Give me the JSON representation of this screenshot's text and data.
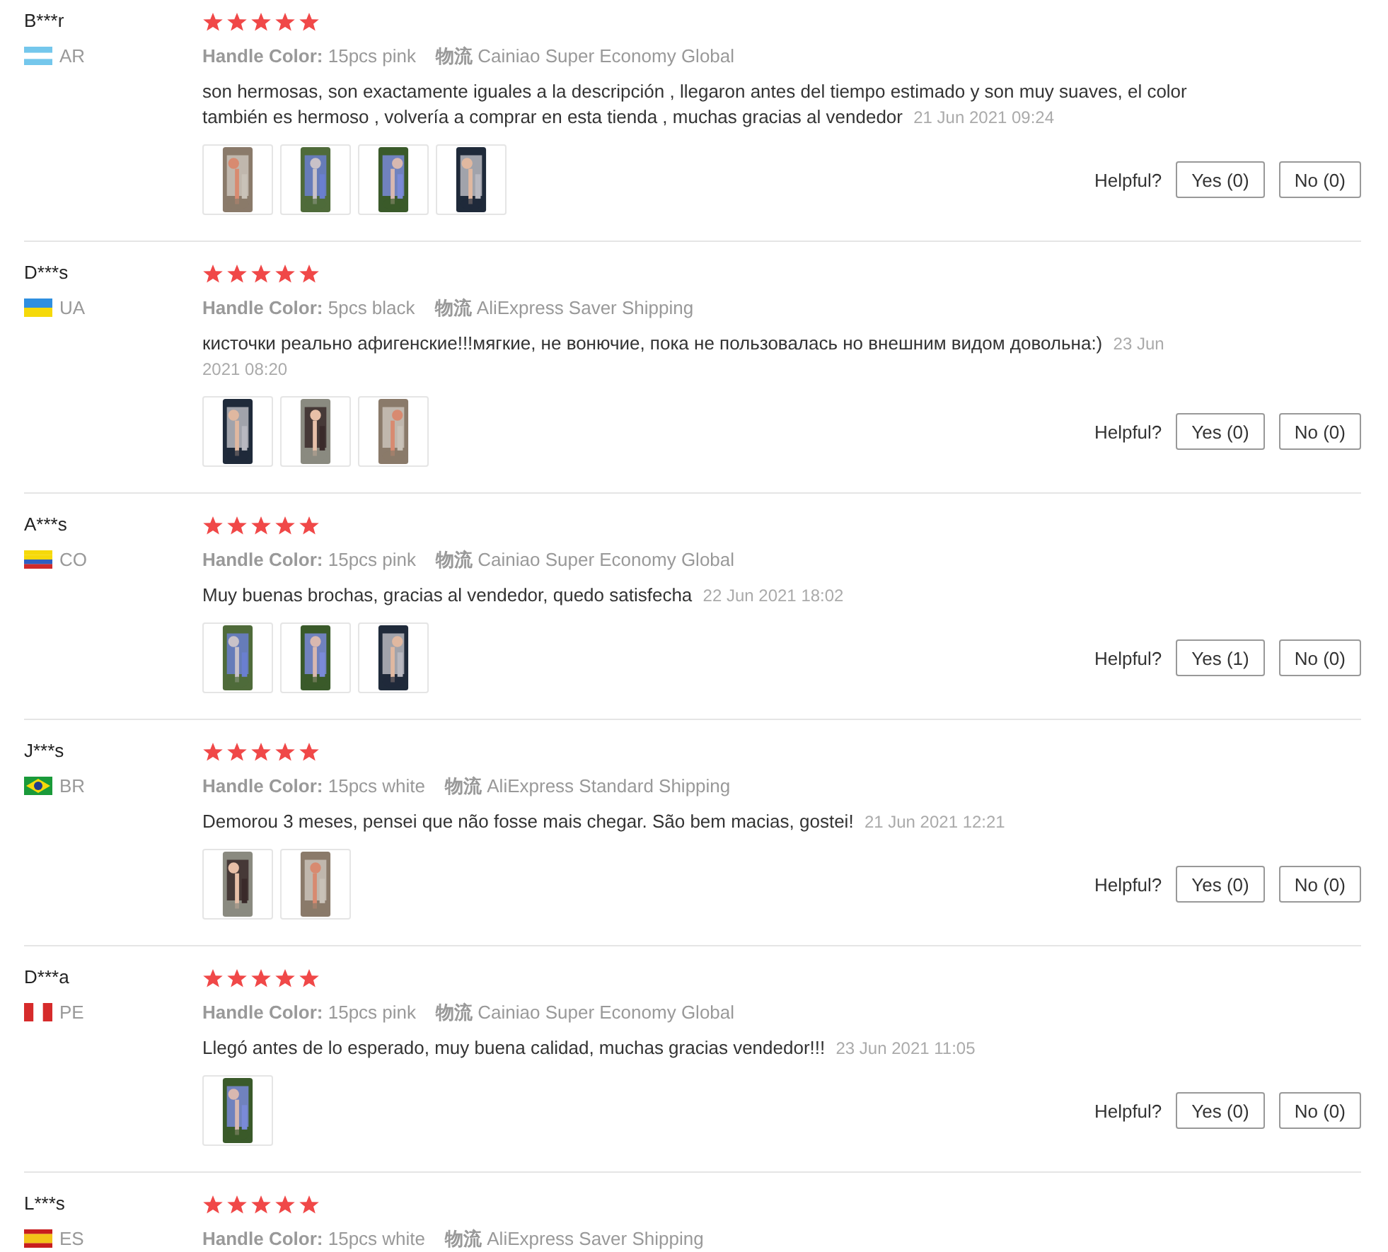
{
  "reviews": [
    {
      "user": "B***r",
      "flag": {
        "kind": "ar"
      },
      "country": "AR",
      "stars": 5,
      "attributes": [
        {
          "label": "Handle Color:",
          "value": "15pcs pink"
        },
        {
          "label": "物流",
          "value": "Cainiao Super Economy Global"
        }
      ],
      "text": "son hermosas, son exactamente iguales a la descripción , llegaron antes del tiempo estimado y son muy suaves, el color también es hermoso , volvería a comprar en esta tienda , muchas gracias al vendedor",
      "date": "21 Jun 2021 09:24",
      "photos": [
        {
          "kind": "picture"
        },
        {
          "kind": "picture"
        },
        {
          "kind": "picture"
        },
        {
          "kind": "picture"
        }
      ],
      "helpful": {
        "label": "Helpful?",
        "yes": "Yes (0)",
        "no": "No (0)"
      }
    },
    {
      "user": "D***s",
      "flag": {
        "kind": "ua"
      },
      "country": "UA",
      "stars": 5,
      "attributes": [
        {
          "label": "Handle Color:",
          "value": "5pcs black"
        },
        {
          "label": "物流",
          "value": "AliExpress Saver Shipping"
        }
      ],
      "text": "кисточки реально афигенские!!!мягкие, не вонючие, пока не пользовалась но внешним видом довольна:)",
      "date": "23 Jun 2021 08:20",
      "photos": [
        {
          "kind": "picture"
        },
        {
          "kind": "picture"
        },
        {
          "kind": "picture"
        }
      ],
      "helpful": {
        "label": "Helpful?",
        "yes": "Yes (0)",
        "no": "No (0)"
      }
    },
    {
      "user": "A***s",
      "flag": {
        "kind": "co"
      },
      "country": "CO",
      "stars": 5,
      "attributes": [
        {
          "label": "Handle Color:",
          "value": "15pcs pink"
        },
        {
          "label": "物流",
          "value": "Cainiao Super Economy Global"
        }
      ],
      "text": "Muy buenas brochas, gracias al vendedor, quedo satisfecha",
      "date": "22 Jun 2021 18:02",
      "photos": [
        {
          "kind": "picture"
        },
        {
          "kind": "picture"
        },
        {
          "kind": "picture"
        }
      ],
      "helpful": {
        "label": "Helpful?",
        "yes": "Yes (1)",
        "no": "No (0)"
      }
    },
    {
      "user": "J***s",
      "flag": {
        "kind": "br"
      },
      "country": "BR",
      "stars": 5,
      "attributes": [
        {
          "label": "Handle Color:",
          "value": "15pcs white"
        },
        {
          "label": "物流",
          "value": "AliExpress Standard Shipping"
        }
      ],
      "text": "Demorou 3 meses, pensei que não fosse mais chegar. São bem macias, gostei!",
      "date": "21 Jun 2021 12:21",
      "photos": [
        {
          "kind": "picture"
        },
        {
          "kind": "picture"
        }
      ],
      "helpful": {
        "label": "Helpful?",
        "yes": "Yes (0)",
        "no": "No (0)"
      }
    },
    {
      "user": "D***a",
      "flag": {
        "kind": "pe"
      },
      "country": "PE",
      "stars": 5,
      "attributes": [
        {
          "label": "Handle Color:",
          "value": "15pcs pink"
        },
        {
          "label": "物流",
          "value": "Cainiao Super Economy Global"
        }
      ],
      "text": "Llegó antes de lo esperado, muy buena calidad, muchas gracias vendedor!!!",
      "date": "23 Jun 2021 11:05",
      "photos": [
        {
          "kind": "picture"
        }
      ],
      "helpful": {
        "label": "Helpful?",
        "yes": "Yes (0)",
        "no": "No (0)"
      }
    },
    {
      "user": "L***s",
      "flag": {
        "kind": "es"
      },
      "country": "ES",
      "stars": 5,
      "attributes": [
        {
          "label": "Handle Color:",
          "value": "15pcs white"
        },
        {
          "label": "物流",
          "value": "AliExpress Saver Shipping"
        }
      ]
    }
  ]
}
